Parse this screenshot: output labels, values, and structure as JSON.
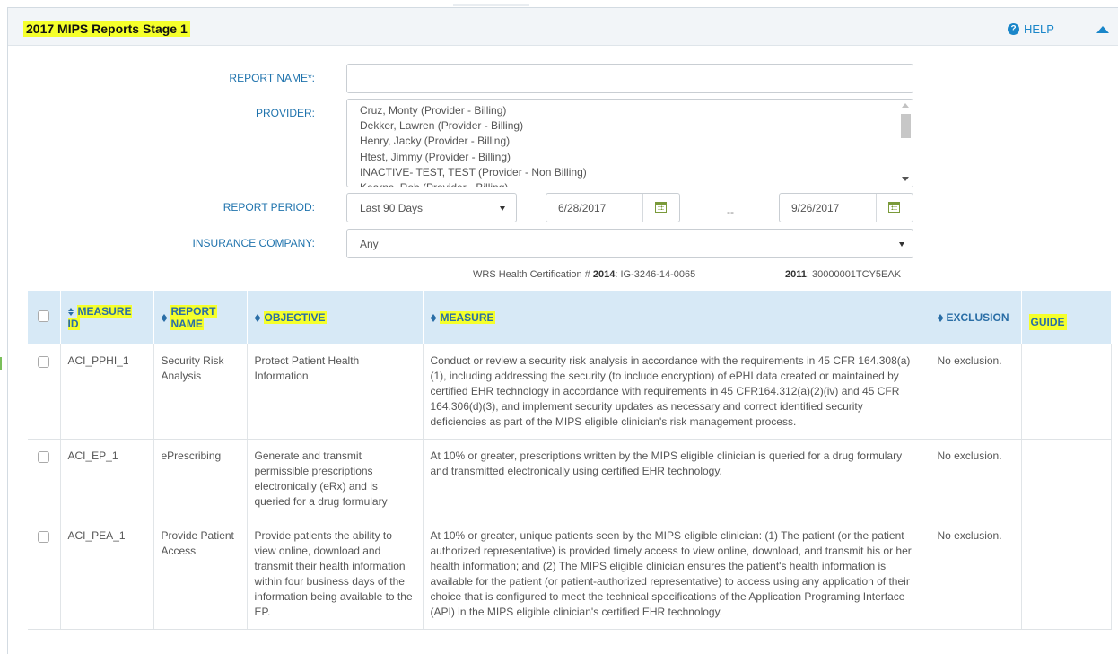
{
  "panel": {
    "title": "2017 MIPS Reports Stage 1",
    "help_label": "HELP"
  },
  "form": {
    "report_name_label": "REPORT NAME*:",
    "report_name_value": "",
    "provider_label": "PROVIDER:",
    "providers": [
      "Cruz, Monty (Provider - Billing)",
      "Dekker, Lawren (Provider - Billing)",
      "Henry, Jacky (Provider - Billing)",
      "Htest, Jimmy (Provider - Billing)",
      "INACTIVE- TEST, TEST (Provider - Non Billing)",
      "Kearns, Rob (Provider - Billing)"
    ],
    "report_period_label": "REPORT PERIOD:",
    "report_period_value": "Last 90 Days",
    "start_date": "6/28/2017",
    "date_separator": "--",
    "end_date": "9/26/2017",
    "insurance_label": "INSURANCE COMPANY:",
    "insurance_value": "Any"
  },
  "certification": {
    "prefix": "WRS Health Certification # ",
    "year_2014": "2014",
    "id_2014": ": IG-3246-14-0065",
    "year_2011": "2011",
    "id_2011": ": 30000001TCY5EAK"
  },
  "table": {
    "columns": {
      "measure_id": "MEASURE ID",
      "report_name_line1": "REPORT",
      "report_name_line2": "NAME",
      "objective": "OBJECTIVE",
      "measure": "MEASURE",
      "exclusion": "EXCLUSION",
      "guide": "GUIDE"
    },
    "rows": [
      {
        "measure_id": "ACI_PPHI_1",
        "report_name": "Security Risk Analysis",
        "objective": "Protect Patient Health Information",
        "measure": "Conduct or review a security risk analysis in accordance with the requirements in 45 CFR 164.308(a)(1), including addressing the security (to include encryption) of ePHI data created or maintained by certified EHR technology in accordance with requirements in 45 CFR164.312(a)(2)(iv) and 45 CFR 164.306(d)(3), and implement security updates as necessary and correct identified security deficiencies as part of the MIPS eligible clinician's risk management process.",
        "exclusion": "No exclusion."
      },
      {
        "measure_id": "ACI_EP_1",
        "report_name": "ePrescribing",
        "objective": "Generate and transmit permissible prescriptions electronically (eRx) and is queried for a drug formulary",
        "measure": "At 10% or greater, prescriptions written by the MIPS eligible clinician is queried for a drug formulary and transmitted electronically using certified EHR technology.",
        "exclusion": "No exclusion."
      },
      {
        "measure_id": "ACI_PEA_1",
        "report_name": "Provide Patient Access",
        "objective": "Provide patients the ability to view online, download and transmit their health information within four business days of the information being available to the EP.",
        "measure": "At 10% or greater, unique patients seen by the MIPS eligible clinician: (1) The patient (or the patient authorized representative) is provided timely access to view online, download, and transmit his or her health information; and (2) The MIPS eligible clinician ensures the patient's health information is available for the patient (or patient-authorized representative) to access using any application of their choice that is configured to meet the technical specifications of the Application Programing Interface (API) in the MIPS eligible clinician's certified EHR technology.",
        "exclusion": "No exclusion."
      }
    ]
  },
  "colors": {
    "accent": "#1a86c9",
    "label": "#1f73ad",
    "header_bg": "#d7e9f6",
    "highlight": "#f5ff2b"
  }
}
